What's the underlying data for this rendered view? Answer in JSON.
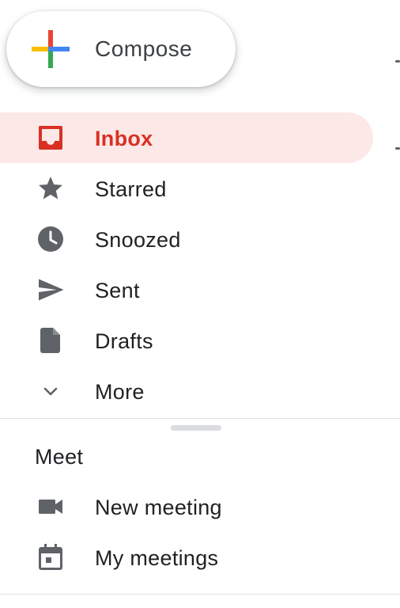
{
  "compose": {
    "label": "Compose",
    "icon": "plus-multicolor-icon",
    "colors": [
      "#ea4335",
      "#fbbc04",
      "#34a853",
      "#4285f4"
    ]
  },
  "nav": {
    "items": [
      {
        "label": "Inbox",
        "icon": "inbox-icon",
        "active": true
      },
      {
        "label": "Starred",
        "icon": "star-icon",
        "active": false
      },
      {
        "label": "Snoozed",
        "icon": "clock-icon",
        "active": false
      },
      {
        "label": "Sent",
        "icon": "send-icon",
        "active": false
      },
      {
        "label": "Drafts",
        "icon": "draft-icon",
        "active": false
      },
      {
        "label": "More",
        "icon": "chevron-down-icon",
        "active": false
      }
    ]
  },
  "meet": {
    "title": "Meet",
    "items": [
      {
        "label": "New meeting",
        "icon": "video-camera-icon"
      },
      {
        "label": "My meetings",
        "icon": "calendar-icon"
      }
    ]
  },
  "colors": {
    "active_bg": "#fce8e6",
    "active_text": "#d93025",
    "icon_gray": "#5f6368",
    "text": "#202124"
  }
}
